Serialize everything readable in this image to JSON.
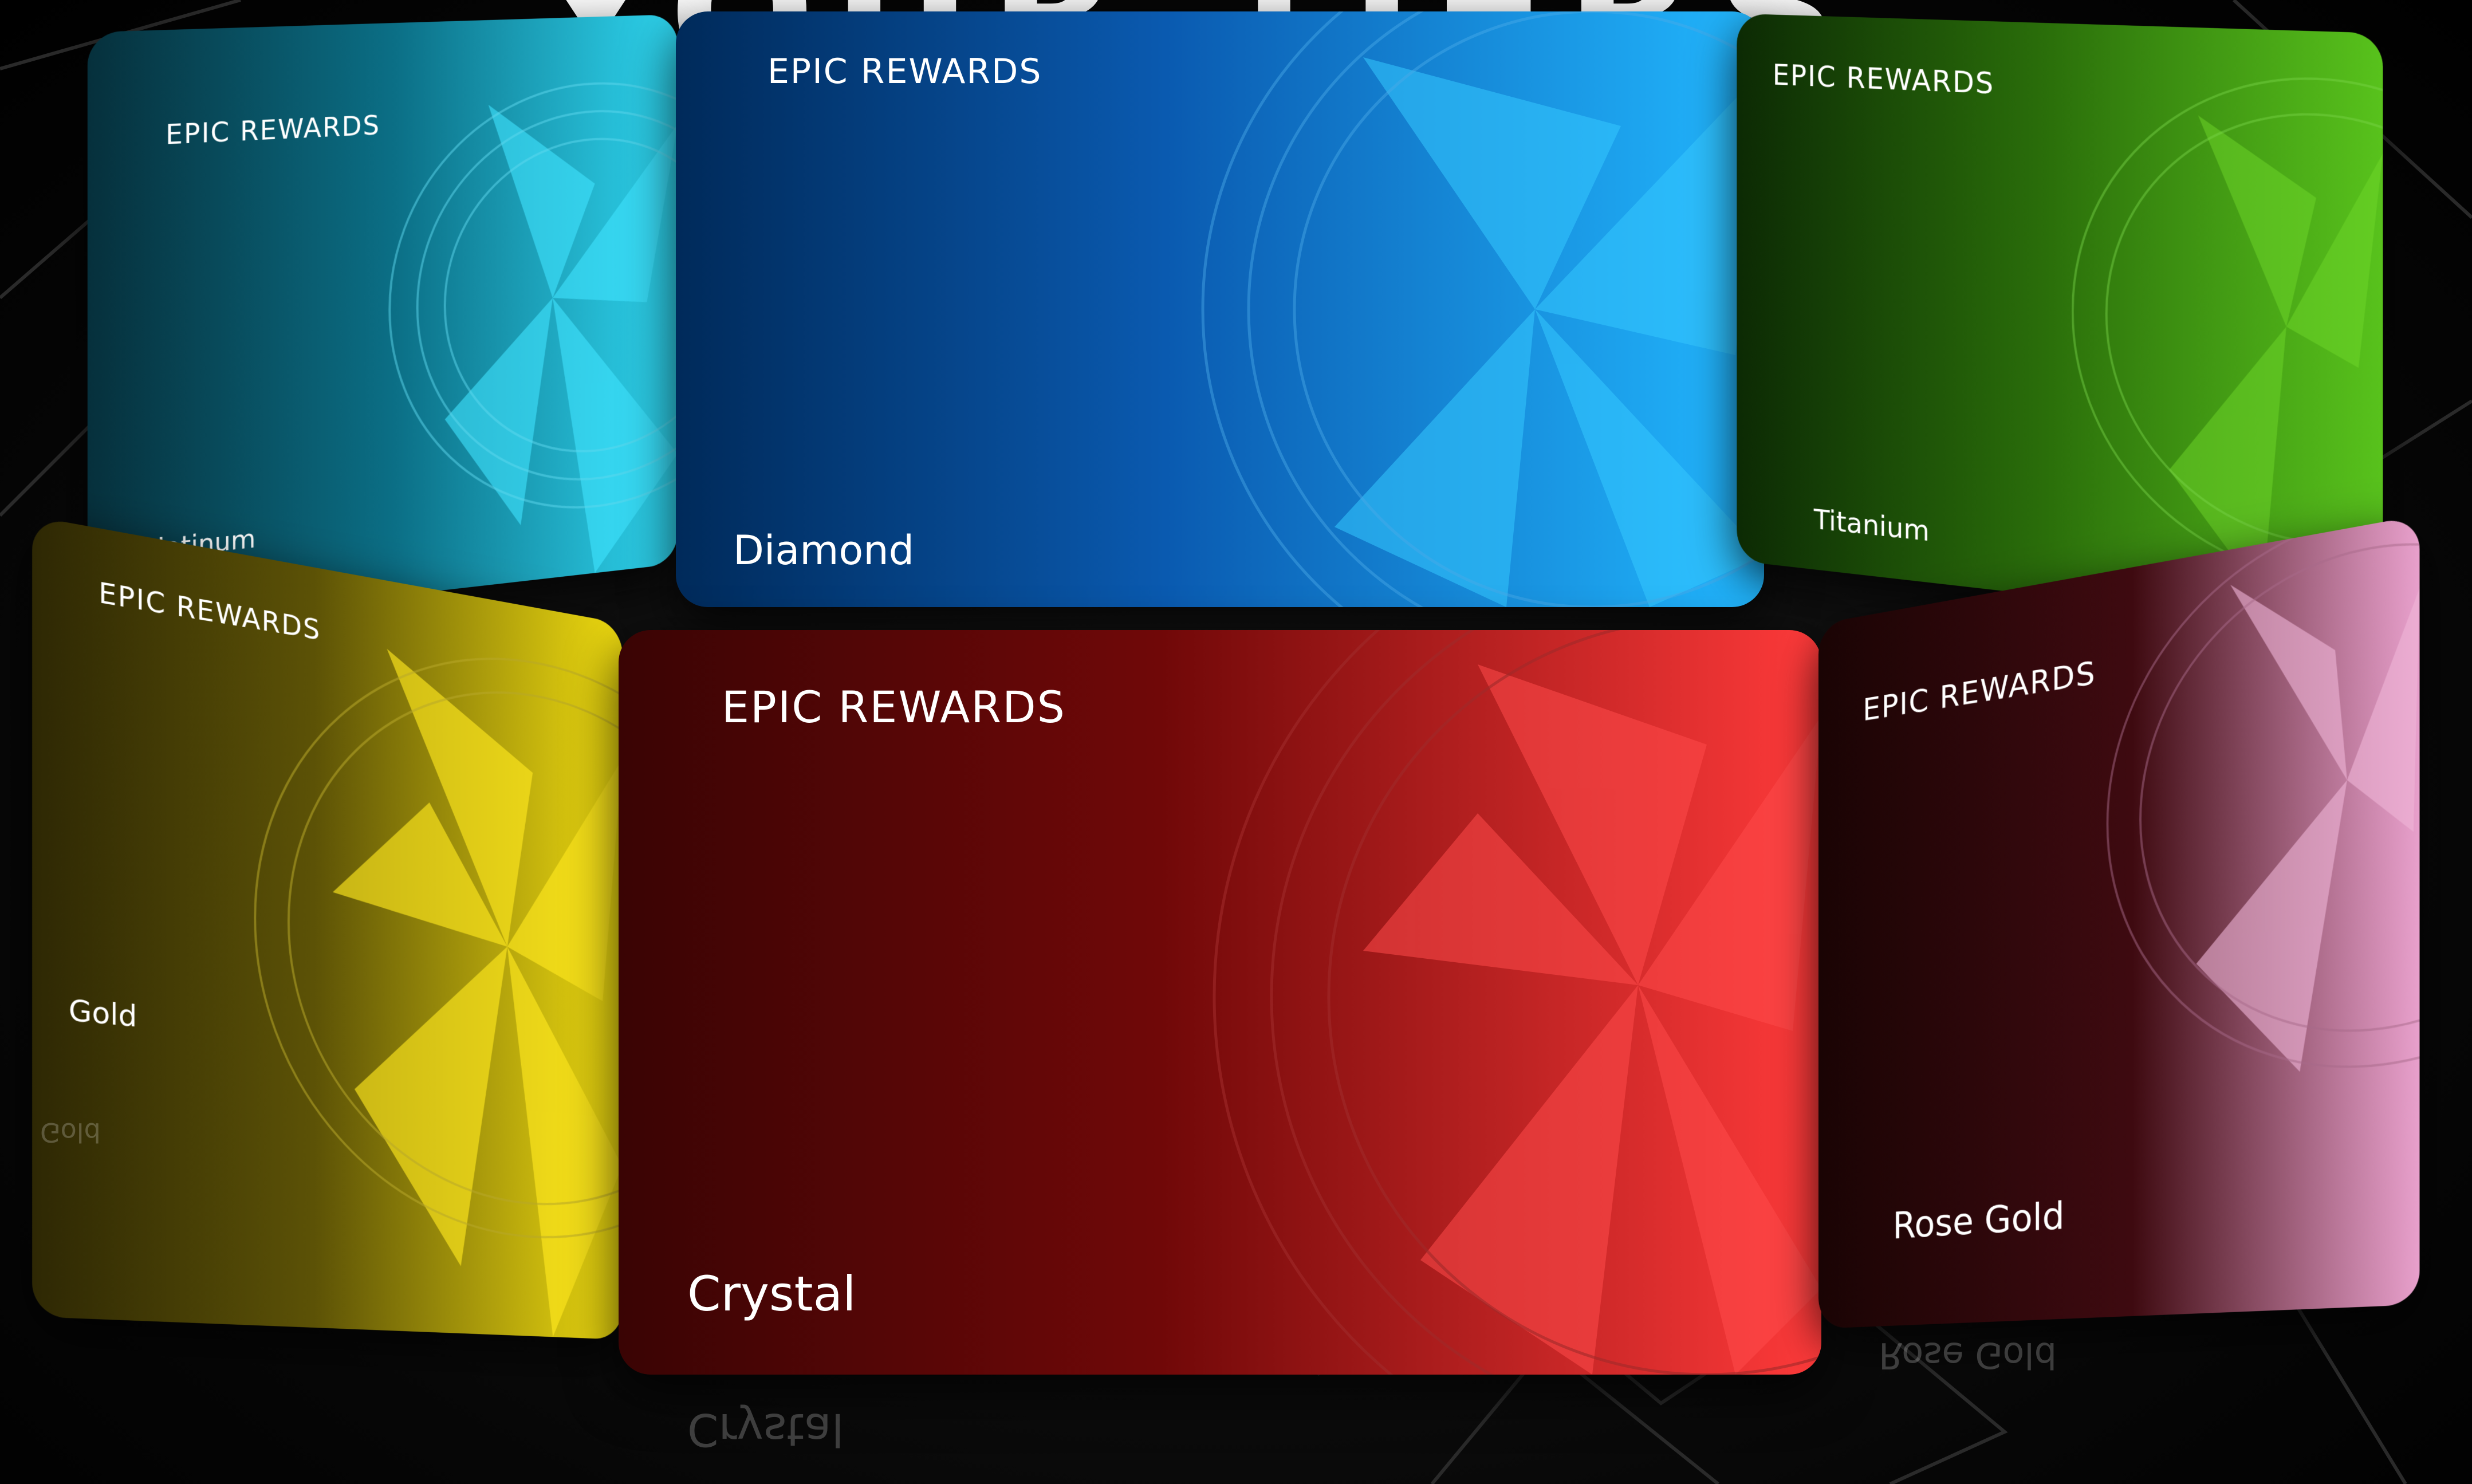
{
  "headline": "YOUR TIERS.",
  "colors": {
    "platinum": "#1ea8c8",
    "diamond": "#1a7fd6",
    "titanium": "#3f9a12",
    "gold": "#d6c200",
    "crystal": "#d01a1a",
    "rose_gold": "#d98fb8"
  },
  "cards": {
    "platinum": {
      "brand": "EPIC REWARDS",
      "tier": "Platinum"
    },
    "diamond": {
      "brand": "EPIC REWARDS",
      "tier": "Diamond"
    },
    "titanium": {
      "brand": "EPIC REWARDS",
      "tier": "Titanium"
    },
    "gold": {
      "brand": "EPIC REWARDS",
      "tier": "Gold"
    },
    "crystal": {
      "brand": "EPIC REWARDS",
      "tier": "Crystal"
    },
    "rose_gold": {
      "brand": "EPIC REWARDS",
      "tier": "Rose Gold"
    }
  }
}
